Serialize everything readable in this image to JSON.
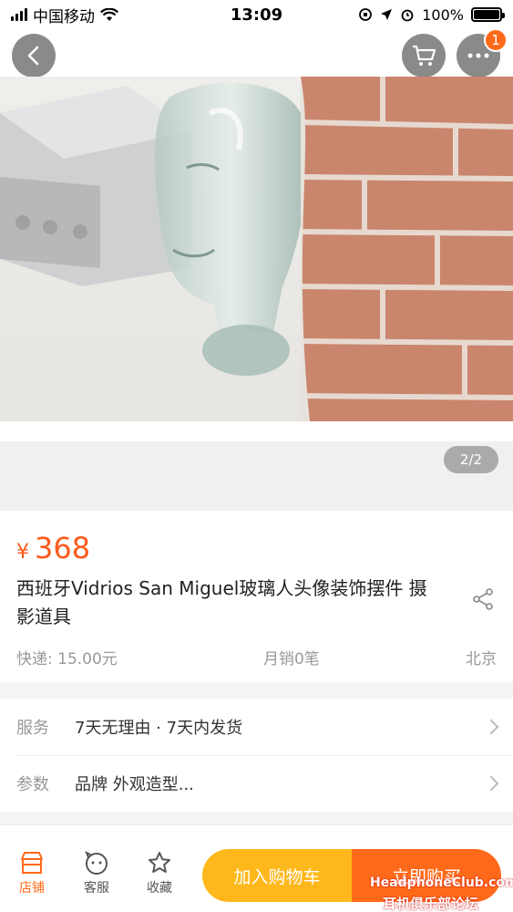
{
  "status_bar": {
    "carrier": "中国移动",
    "time": "13:09",
    "battery": "100%",
    "battery_level": 1.0
  },
  "nav": {
    "cart_badge": "1"
  },
  "gallery": {
    "page_indicator": "2/2"
  },
  "product": {
    "currency_symbol": "¥",
    "price": "368",
    "title": "西班牙Vidrios San Miguel玻璃人头像装饰摆件 摄影道具",
    "shipping": "快递: 15.00元",
    "monthly_sales": "月销0笔",
    "location": "北京"
  },
  "services": {
    "service_label": "服务",
    "service_value": "7天无理由 · 7天内发货",
    "params_label": "参数",
    "params_value": "品牌 外观造型..."
  },
  "bottom_bar": {
    "shop_label": "店铺",
    "service_label": "客服",
    "favorite_label": "收藏",
    "add_to_cart_label": "加入购物车",
    "buy_now_label": "立即购买"
  },
  "watermark": {
    "line1": "HeadphoneClub.com",
    "line2": "耳机俱乐部论坛"
  },
  "colors": {
    "accent": "#ff6a1a",
    "cart_button": "#ffb81c"
  }
}
